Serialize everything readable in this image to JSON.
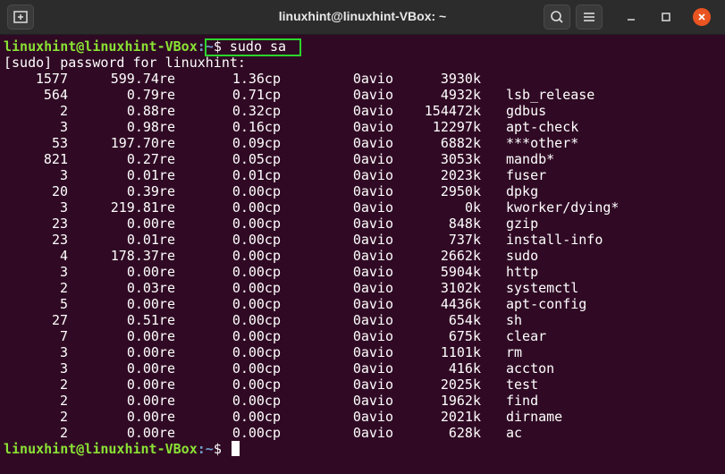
{
  "window": {
    "title": "linuxhint@linuxhint-VBox: ~"
  },
  "prompt": {
    "user_host": "linuxhint@linuxhint-VBox",
    "path": ":~",
    "symbol": "$"
  },
  "command": " sudo sa",
  "password_line": "[sudo] password for linuxhint:",
  "rows": [
    {
      "calls": "1577",
      "real": "599.74re",
      "cpu": "1.36cp",
      "io": "0avio",
      "mem": "3930k",
      "name": ""
    },
    {
      "calls": "564",
      "real": "0.79re",
      "cpu": "0.71cp",
      "io": "0avio",
      "mem": "4932k",
      "name": "lsb_release"
    },
    {
      "calls": "2",
      "real": "0.88re",
      "cpu": "0.32cp",
      "io": "0avio",
      "mem": "154472k",
      "name": "gdbus"
    },
    {
      "calls": "3",
      "real": "0.98re",
      "cpu": "0.16cp",
      "io": "0avio",
      "mem": "12297k",
      "name": "apt-check"
    },
    {
      "calls": "53",
      "real": "197.70re",
      "cpu": "0.09cp",
      "io": "0avio",
      "mem": "6882k",
      "name": "***other*"
    },
    {
      "calls": "821",
      "real": "0.27re",
      "cpu": "0.05cp",
      "io": "0avio",
      "mem": "3053k",
      "name": "mandb*"
    },
    {
      "calls": "3",
      "real": "0.01re",
      "cpu": "0.01cp",
      "io": "0avio",
      "mem": "2023k",
      "name": "fuser"
    },
    {
      "calls": "20",
      "real": "0.39re",
      "cpu": "0.00cp",
      "io": "0avio",
      "mem": "2950k",
      "name": "dpkg"
    },
    {
      "calls": "3",
      "real": "219.81re",
      "cpu": "0.00cp",
      "io": "0avio",
      "mem": "0k",
      "name": "kworker/dying*"
    },
    {
      "calls": "23",
      "real": "0.00re",
      "cpu": "0.00cp",
      "io": "0avio",
      "mem": "848k",
      "name": "gzip"
    },
    {
      "calls": "23",
      "real": "0.01re",
      "cpu": "0.00cp",
      "io": "0avio",
      "mem": "737k",
      "name": "install-info"
    },
    {
      "calls": "4",
      "real": "178.37re",
      "cpu": "0.00cp",
      "io": "0avio",
      "mem": "2662k",
      "name": "sudo"
    },
    {
      "calls": "3",
      "real": "0.00re",
      "cpu": "0.00cp",
      "io": "0avio",
      "mem": "5904k",
      "name": "http"
    },
    {
      "calls": "2",
      "real": "0.03re",
      "cpu": "0.00cp",
      "io": "0avio",
      "mem": "3102k",
      "name": "systemctl"
    },
    {
      "calls": "5",
      "real": "0.00re",
      "cpu": "0.00cp",
      "io": "0avio",
      "mem": "4436k",
      "name": "apt-config"
    },
    {
      "calls": "27",
      "real": "0.51re",
      "cpu": "0.00cp",
      "io": "0avio",
      "mem": "654k",
      "name": "sh"
    },
    {
      "calls": "7",
      "real": "0.00re",
      "cpu": "0.00cp",
      "io": "0avio",
      "mem": "675k",
      "name": "clear"
    },
    {
      "calls": "3",
      "real": "0.00re",
      "cpu": "0.00cp",
      "io": "0avio",
      "mem": "1101k",
      "name": "rm"
    },
    {
      "calls": "3",
      "real": "0.00re",
      "cpu": "0.00cp",
      "io": "0avio",
      "mem": "416k",
      "name": "accton"
    },
    {
      "calls": "2",
      "real": "0.00re",
      "cpu": "0.00cp",
      "io": "0avio",
      "mem": "2025k",
      "name": "test"
    },
    {
      "calls": "2",
      "real": "0.00re",
      "cpu": "0.00cp",
      "io": "0avio",
      "mem": "1962k",
      "name": "find"
    },
    {
      "calls": "2",
      "real": "0.00re",
      "cpu": "0.00cp",
      "io": "0avio",
      "mem": "2021k",
      "name": "dirname"
    },
    {
      "calls": "2",
      "real": "0.00re",
      "cpu": "0.00cp",
      "io": "0avio",
      "mem": "628k",
      "name": "ac"
    }
  ],
  "colors": {
    "background": "#300a24",
    "prompt_user": "#8ae234",
    "prompt_path": "#729fcf",
    "highlight_border": "#2bd52b",
    "close_button": "#e95420"
  },
  "icons": {
    "new_tab": "new-tab-icon",
    "search": "search-icon",
    "menu": "hamburger-menu-icon",
    "minimize": "minimize-icon",
    "maximize": "maximize-icon",
    "close": "close-icon"
  }
}
